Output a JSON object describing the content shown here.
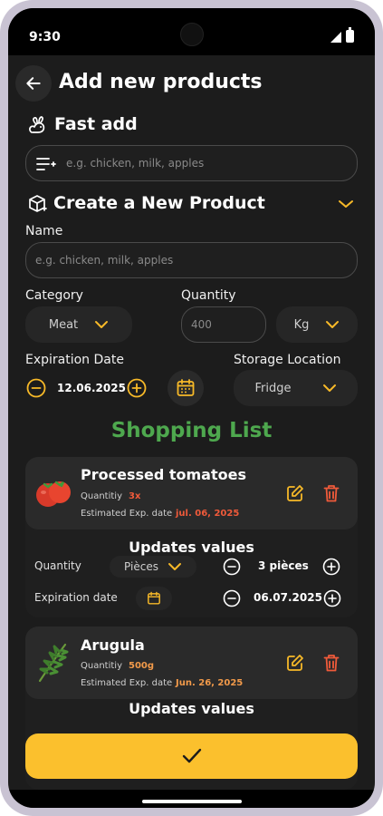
{
  "status_bar": {
    "time": "9:30"
  },
  "header": {
    "title": "Add new products"
  },
  "fast_add": {
    "title": "Fast add",
    "placeholder": "e.g. chicken, milk, apples"
  },
  "create_product": {
    "title": "Create a New Product",
    "name_label": "Name",
    "name_placeholder": "e.g. chicken, milk, apples",
    "category_label": "Category",
    "category_value": "Meat",
    "quantity_label": "Quantity",
    "quantity_placeholder": "400",
    "unit_value": "Kg",
    "expiration_label": "Expiration Date",
    "expiration_value": "12.06.2025",
    "storage_label": "Storage Location",
    "storage_value": "Fridge"
  },
  "shopping_list": {
    "title": "Shopping List",
    "items": [
      {
        "name": "Processed tomatoes",
        "quantity_label": "Quantitiy",
        "quantity_value": "3x",
        "exp_label": "Estimated Exp. date",
        "exp_value": "jul. 06, 2025",
        "updates_title": "Updates values",
        "row_quantity_label": "Quantity",
        "unit_select": "Pièces",
        "stepper_quantity": "3 pièces",
        "row_exp_label": "Expiration date",
        "stepper_date": "06.07.2025"
      },
      {
        "name": "Arugula",
        "quantity_label": "Quantitiy",
        "quantity_value": "500g",
        "exp_label": "Estimated Exp. date",
        "exp_value": "Jun. 26, 2025",
        "updates_title": "Updates values"
      }
    ]
  },
  "colors": {
    "accent": "#f7b928",
    "green": "#4ea84e",
    "danger": "#ef5a3a",
    "confirm": "#fbc02d"
  }
}
